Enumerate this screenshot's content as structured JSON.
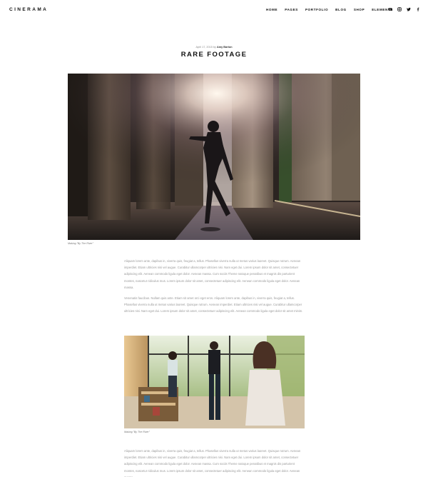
{
  "site": {
    "logo": "CINERAMA"
  },
  "nav": {
    "items": [
      "HOME",
      "PAGES",
      "PORTFOLIO",
      "BLOG",
      "SHOP",
      "ELEMENTS"
    ]
  },
  "social": {
    "icons": [
      "youtube-icon",
      "instagram-icon",
      "twitter-icon",
      "facebook-icon"
    ]
  },
  "post": {
    "date": "April 17, 2015",
    "by": "by",
    "author": "Amy Barton",
    "title": "RARE FOOTAGE",
    "hero_caption": "Making \"By The River\"",
    "paragraph1": "Aliquam lorem ante, dapibus in, viverra quis, feugiat a, tellus. Phasellus viverra nulla ut metus varius laoreet. Quisque rutrum. Aenean imperdiet. Etiam ultricies nisi vel augue. Curabitur ullamcorper ultricies nisi. Nam eget dui. Lorem ipsum dolor sit amet, consectetuer adipiscing elit. Aenean commodo ligula eget dolor. Aenean massa. Cum sociis Theme natoque penatibus et magnis dis parturient montes, nascetur ridiculus mus. Lorem ipsum dolor sit amet, consectetuer adipiscing elit. Aenean commodo ligula eget dolor. Aenean massa.",
    "paragraph2": "Venenatis faucibus. Nullam quis ante. Etiam sit amet orci eget eros. Aliquam lorem ante, dapibus in, viverra quis, feugiat a, tellus. Phasellus viverra nulla ut metus varius laoreet. Quisque rutrum. Aenean imperdiet. Etiam ultricies nisi vel augue. Curabitur ullamcorper ultricies nisi. Nam eget dui. Lorem ipsum dolor sit amet, consectetuer adipiscing elit. Aenean commodo ligula eget dolor sit amet minim.",
    "image2_caption": "Making \"By The River\"",
    "paragraph3": "Aliquam lorem ante, dapibus in, viverra quis, feugiat a, tellus. Phasellus viverra nulla ut metus varius laoreet. Quisque rutrum. Aenean imperdiet. Etiam ultricies nisi vel augue. Curabitur ullamcorper ultricies nisi. Nam eget dui. Lorem ipsum dolor sit amet, consectetuer adipiscing elit. Aenean commodo ligula eget dolor. Aenean massa. Cum sociis Theme natoque penatibus et magnis dis parturient montes, nascetur ridiculus mus. Lorem ipsum dolor sit amet, consectetuer adipiscing elit. Aenean commodo ligula eget dolor. Aenean massa."
  }
}
